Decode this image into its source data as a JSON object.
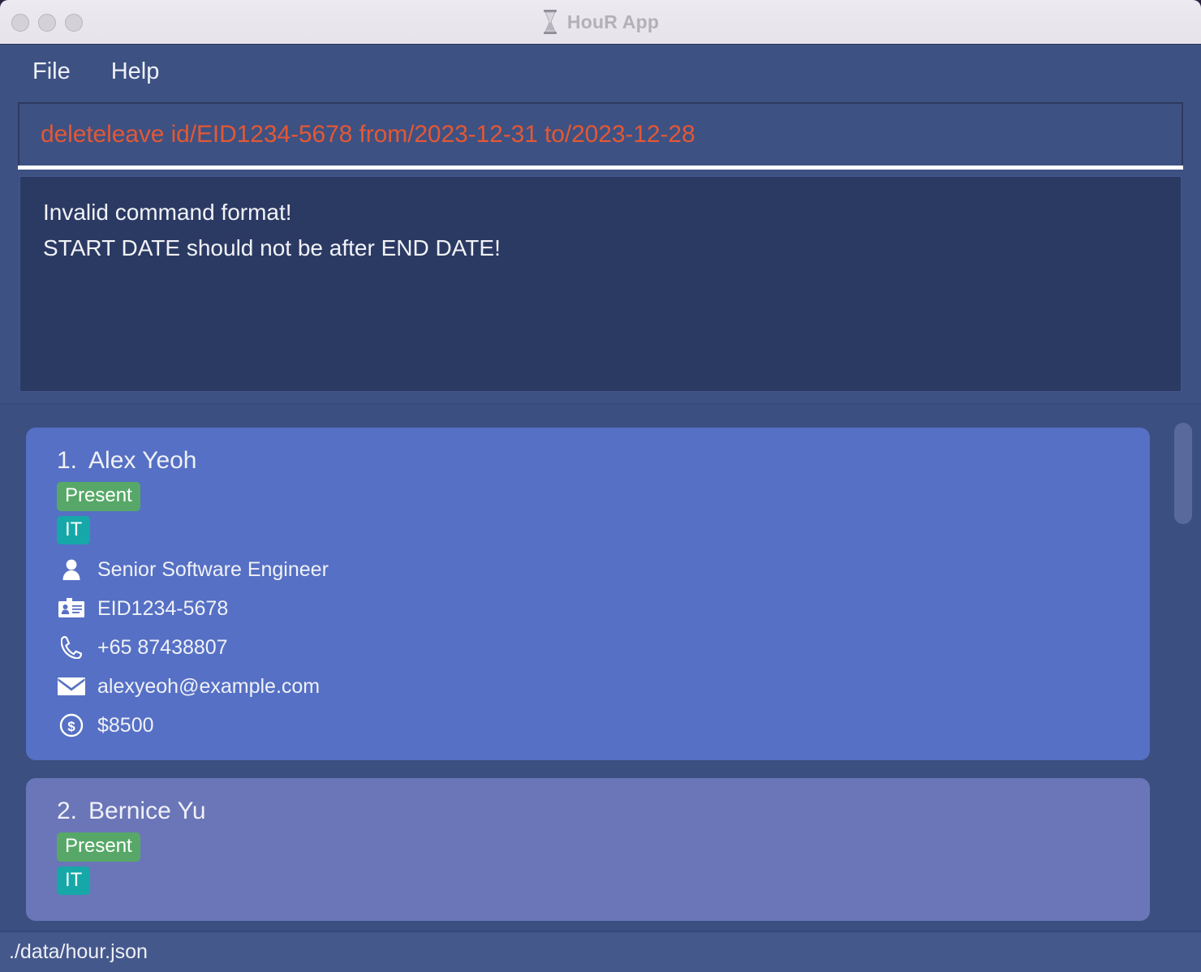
{
  "window": {
    "title": "HouR App",
    "title_icon": "hourglass-icon",
    "controls": [
      "close-button",
      "minimize-button",
      "maximize-button"
    ]
  },
  "menubar": {
    "items": [
      {
        "label": "File"
      },
      {
        "label": "Help"
      }
    ]
  },
  "command_input": {
    "value": "deleteleave id/EID1234-5678 from/2023-12-31 to/2023-12-28",
    "placeholder": "Enter command here...",
    "text_color": "#e35834",
    "state": "error"
  },
  "result_display": {
    "lines": [
      "Invalid command format!",
      "START DATE should not be after END DATE!"
    ]
  },
  "person_list": {
    "persons": [
      {
        "index": "1.",
        "name": "Alex Yeoh",
        "attendance": "Present",
        "department": "IT",
        "role": "Senior Software Engineer",
        "employee_id": "EID1234-5678",
        "phone": "+65 87438807",
        "email": "alexyeoh@example.com",
        "salary": "$8500",
        "icons": {
          "role": "person-icon",
          "employee_id": "id-card-icon",
          "phone": "phone-icon",
          "email": "envelope-icon",
          "salary": "dollar-circle-icon"
        }
      },
      {
        "index": "2.",
        "name": "Bernice Yu",
        "attendance": "Present",
        "department": "IT",
        "role": "",
        "employee_id": "",
        "phone": "",
        "email": "",
        "salary": "",
        "icons": {}
      }
    ]
  },
  "statusbar": {
    "file_path": "./data/hour.json"
  },
  "colors": {
    "window_background": "#3d5183",
    "menubar": "#3d5183",
    "result_box": "#2b3a63",
    "list_panel": "#3b4f80",
    "card_primary": "#5570c4",
    "card_alternate": "#6a76b8",
    "badge_attendance": "#57a868",
    "badge_department": "#16a8a8",
    "error_text": "#e35834",
    "statusbar": "#45588c",
    "titlebar": "#eceaf0"
  }
}
